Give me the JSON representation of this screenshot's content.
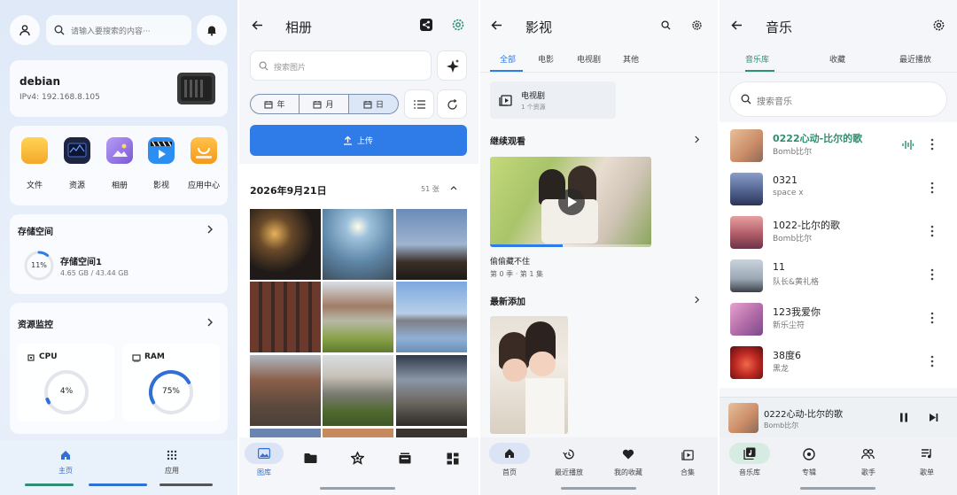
{
  "home": {
    "search_placeholder": "请输入要搜索的内容···",
    "device_name": "debian",
    "device_ip": "IPv4: 192.168.8.105",
    "apps": [
      {
        "label": "文件",
        "icon": "folder-icon",
        "color": "#f5b731"
      },
      {
        "label": "资源",
        "icon": "resource-monitor-icon",
        "color": "#1f2a44"
      },
      {
        "label": "相册",
        "icon": "album-icon",
        "color": "#8e6fd8"
      },
      {
        "label": "影视",
        "icon": "video-icon",
        "color": "#2b8ef0"
      },
      {
        "label": "应用中心",
        "icon": "store-icon",
        "color": "#f5a623"
      }
    ],
    "storage_title": "存储空间",
    "storage_percent": "11%",
    "storage_percent_value": 11,
    "storage_name": "存储空间1",
    "storage_detail": "4.65 GB / 43.44 GB",
    "monitor_title": "资源监控",
    "cpu_label": "CPU",
    "cpu_value": "4%",
    "cpu_percent": 4,
    "ram_label": "RAM",
    "ram_value": "75%",
    "ram_percent": 75,
    "nav_home": "主页",
    "nav_apps": "应用"
  },
  "album": {
    "title": "相册",
    "search_placeholder": "搜索图片",
    "seg_year": "年",
    "seg_month": "月",
    "seg_day": "日",
    "upload_label": "上传",
    "date_heading": "2026年9月21日",
    "count": "51 张",
    "nav_gallery": "图库",
    "accent": "#2f7ce8"
  },
  "video": {
    "title": "影视",
    "tabs": [
      "全部",
      "电影",
      "电视剧",
      "其他"
    ],
    "category_title": "电视剧",
    "category_count": "1 个资源",
    "continue_title": "继续观看",
    "show_title": "偷偷藏不住",
    "show_episode": "第 0 季 · 第 1 集",
    "recent_title": "最新添加",
    "nav": [
      "首页",
      "最近播放",
      "我的收藏",
      "合集"
    ]
  },
  "music": {
    "title": "音乐",
    "tabs": [
      "音乐库",
      "收藏",
      "最近播放"
    ],
    "search_placeholder": "搜索音乐",
    "songs": [
      {
        "title": "0222心动-比尔的歌",
        "artist": "Bomb比尔",
        "art": "#d9a77f",
        "playing": true
      },
      {
        "title": "0321",
        "artist": "space x",
        "art": "#5a6f9a",
        "playing": false
      },
      {
        "title": "1022-比尔的歌",
        "artist": "Bomb比尔",
        "art": "#c06a6f",
        "playing": false
      },
      {
        "title": "11",
        "artist": "队长&黄礼格",
        "art": "#9aa6b4",
        "playing": false
      },
      {
        "title": "123我爱你",
        "artist": "新乐尘符",
        "art": "#c77fb0",
        "playing": false
      },
      {
        "title": "38度6",
        "artist": "黑龙",
        "art": "#c0302c",
        "playing": false
      }
    ],
    "now_playing_title": "0222心动-比尔的歌",
    "now_playing_artist": "Bomb比尔",
    "nav": [
      "音乐库",
      "专辑",
      "歌手",
      "歌单"
    ],
    "accent": "#2f8f6e"
  }
}
